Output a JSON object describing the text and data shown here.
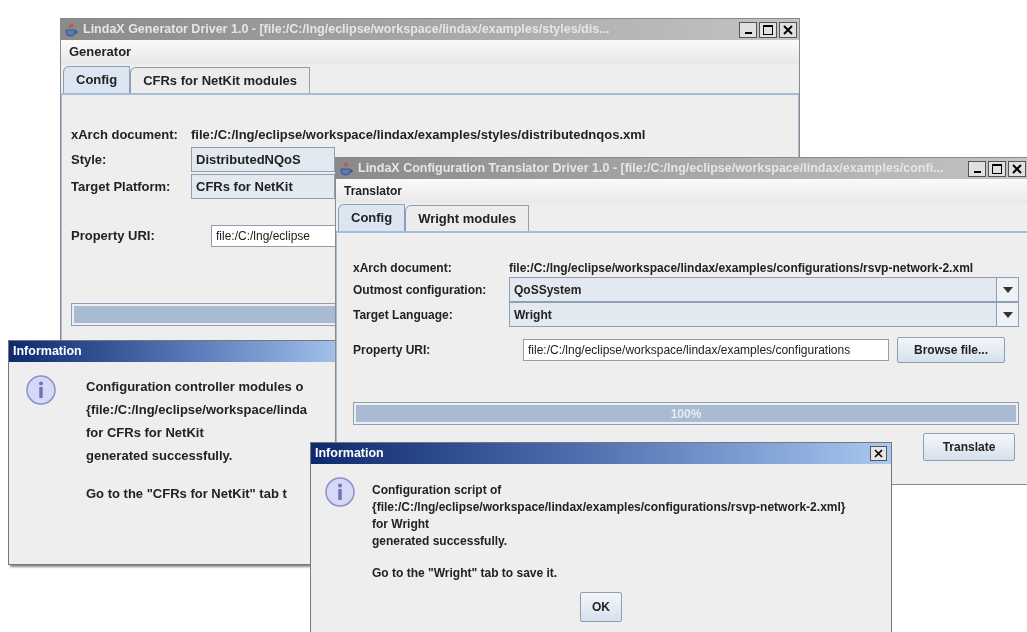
{
  "generator_window": {
    "title": "LindaX Generator Driver 1.0 - [file:/C:/lng/eclipse/workspace/lindax/examples/styles/dis...",
    "menu": [
      {
        "label": "Generator"
      }
    ],
    "tabs": [
      {
        "label": "Config",
        "selected": true
      },
      {
        "label": "CFRs for NetKit modules",
        "selected": false
      }
    ],
    "rows": [
      {
        "kind": "text",
        "label": "xArch document:",
        "value": "file:/C:/lng/eclipse/workspace/lindax/examples/styles/distributednqos.xml"
      },
      {
        "kind": "combo",
        "label": "Style:",
        "value": "DistributedNQoS"
      },
      {
        "kind": "combo",
        "label": "Target Platform:",
        "value": "CFRs for NetKit"
      },
      {
        "kind": "input",
        "label": "Property URI:",
        "value": "file:/C:/lng/eclipse"
      }
    ],
    "progress": {
      "level": 1
    }
  },
  "info_dialog_back": {
    "title": "Information",
    "lines": [
      "Configuration controller modules o",
      "{file:/C:/lng/eclipse/workspace/linda",
      "for CFRs for NetKit",
      "generated successfully."
    ],
    "note": "Go to the \"CFRs for NetKit\" tab t"
  },
  "translator_window": {
    "title": "LindaX Configuration Translator Driver 1.0 - [file:/C:/lng/eclipse/workspace/lindax/examples/confi...",
    "menu": [
      {
        "label": "Translator"
      }
    ],
    "tabs": [
      {
        "label": "Config",
        "selected": true
      },
      {
        "label": "Wright modules",
        "selected": false
      }
    ],
    "rows": [
      {
        "kind": "text",
        "label": "xArch document:",
        "value": "file:/C:/lng/eclipse/workspace/lindax/examples/configurations/rsvp-network-2.xml"
      },
      {
        "kind": "combo",
        "label": "Outmost configuration:",
        "value": "QoSSystem"
      },
      {
        "kind": "combo",
        "label": "Target Language:",
        "value": "Wright"
      },
      {
        "kind": "input",
        "label": "Property URI:",
        "value": "file:/C:/lng/eclipse/workspace/lindax/examples/configurations",
        "button": "Browse file..."
      }
    ],
    "progress": {
      "level": 1,
      "reading": "100%"
    },
    "action_button": "Translate"
  },
  "info_dialog_front": {
    "title": "Information",
    "lines": [
      "Configuration script of",
      "{file:/C:/lng/eclipse/workspace/lindax/examples/configurations/rsvp-network-2.xml}",
      "for Wright",
      "generated successfully."
    ],
    "note": "Go to the \"Wright\" tab to save it.",
    "ok_button": "OK"
  }
}
